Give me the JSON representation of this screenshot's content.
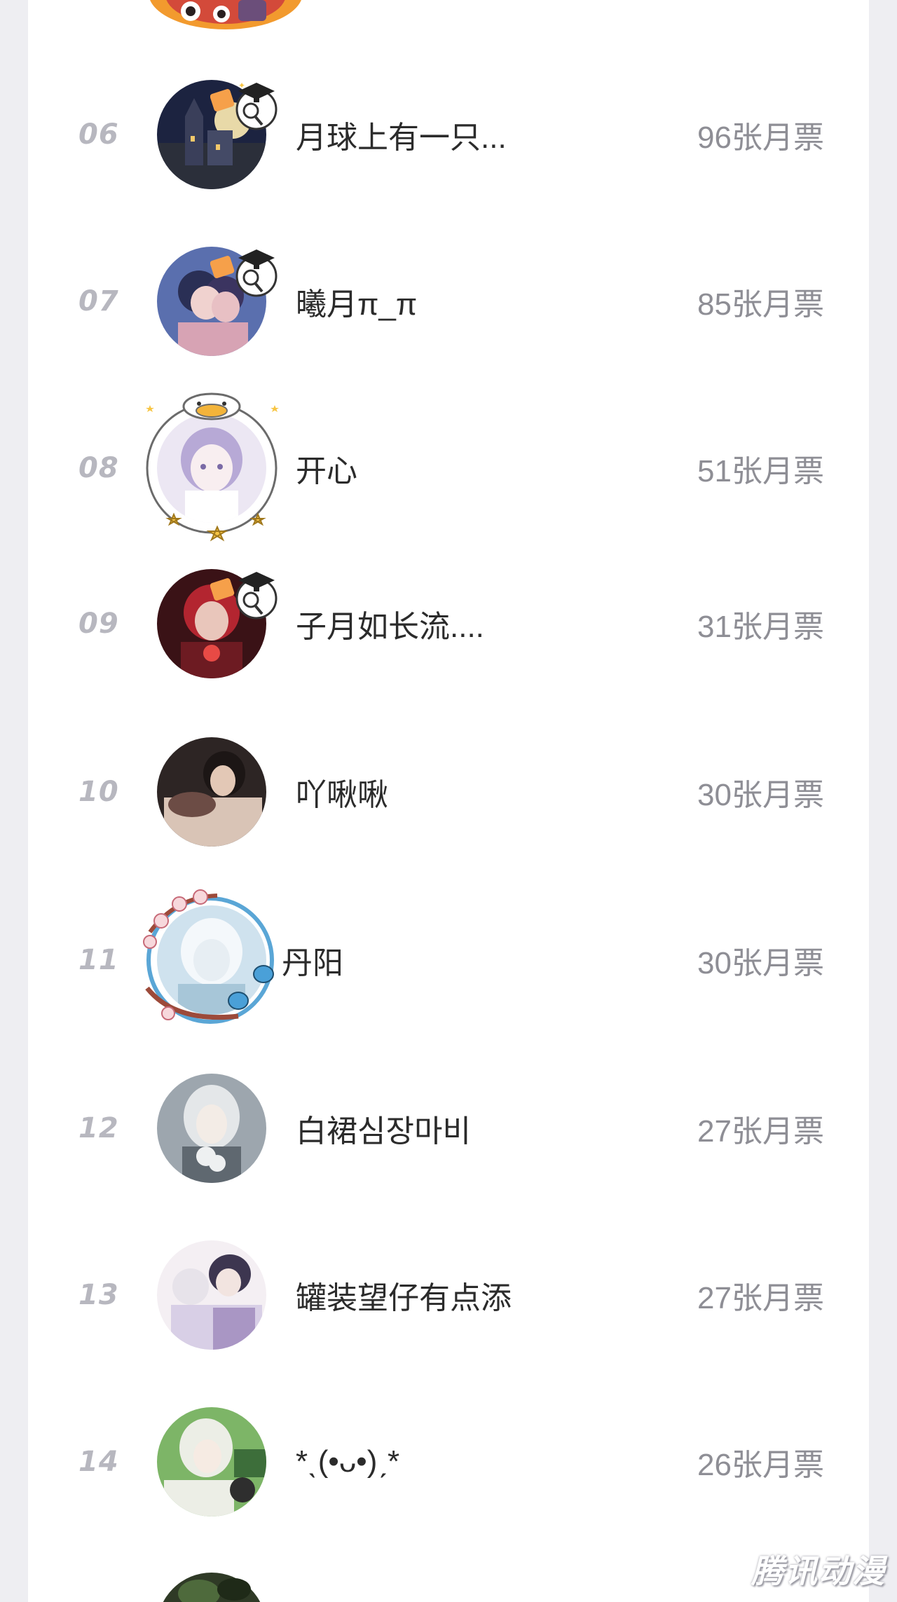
{
  "ranking": {
    "rows": [
      {
        "rank": "06",
        "name": "月球上有一只...",
        "votes": "96张月票",
        "avatar_colors": [
          "#1c2340",
          "#3c4a7a",
          "#e8d9a8"
        ]
      },
      {
        "rank": "07",
        "name": "曦月π_π",
        "votes": "85张月票",
        "avatar_colors": [
          "#5a6fae",
          "#d7a3b4",
          "#2a2f55"
        ]
      },
      {
        "rank": "08",
        "name": "开心",
        "votes": "51张月票",
        "avatar_colors": [
          "#ece7f3",
          "#b7a9d6",
          "#ffffff"
        ]
      },
      {
        "rank": "09",
        "name": "子月如长流....",
        "votes": "31张月票",
        "avatar_colors": [
          "#3a1216",
          "#b32530",
          "#e9c6bb"
        ]
      },
      {
        "rank": "10",
        "name": "吖啾啾",
        "votes": "30张月票",
        "avatar_colors": [
          "#2d2524",
          "#d9c4b6",
          "#6c4c45"
        ]
      },
      {
        "rank": "11",
        "name": "丹阳",
        "votes": "30张月票",
        "avatar_colors": [
          "#cfe2ee",
          "#a7c6d8",
          "#f4f8fb"
        ]
      },
      {
        "rank": "12",
        "name": "白裙심장마비",
        "votes": "27张月票",
        "avatar_colors": [
          "#9da6ae",
          "#eef0f1",
          "#5f6870"
        ]
      },
      {
        "rank": "13",
        "name": "罐装望仔有点添",
        "votes": "27张月票",
        "avatar_colors": [
          "#d8cfe6",
          "#a996c4",
          "#f4eff3"
        ]
      },
      {
        "rank": "14",
        "name": "*ˎ(•ᴗ•)ˏ*",
        "votes": "26张月票",
        "avatar_colors": [
          "#7db567",
          "#eceee6",
          "#3d6e3a"
        ]
      }
    ]
  },
  "watermark": {
    "text": "腾讯动漫"
  },
  "colors": {
    "background": "#eeeef2",
    "panel": "#ffffff",
    "rank_text": "#b7b7bf",
    "name_text": "#2b2b2b",
    "votes_text": "#8e8e95",
    "badge_orange": "#f6a04a",
    "badge_gold": "#f7c544"
  }
}
